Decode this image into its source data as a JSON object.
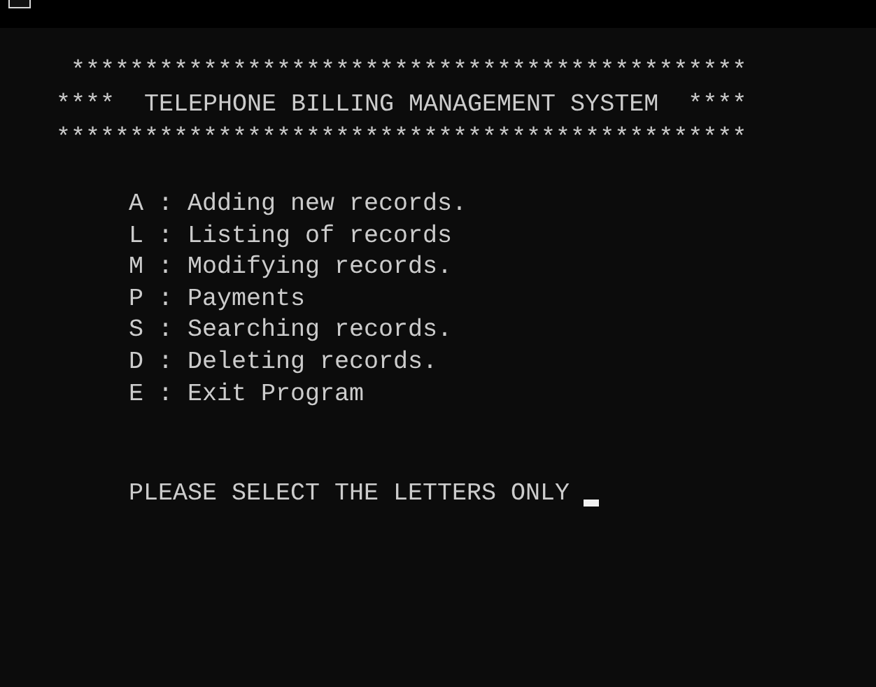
{
  "banner": [
    " **********************************************",
    "****  TELEPHONE BILLING MANAGEMENT SYSTEM  ****",
    "***********************************************"
  ],
  "menu": [
    "A : Adding new records.",
    "L : Listing of records",
    "M : Modifying records.",
    "P : Payments",
    "S : Searching records.",
    "D : Deleting records.",
    "E : Exit Program"
  ],
  "prompt": "PLEASE SELECT THE LETTERS ONLY"
}
